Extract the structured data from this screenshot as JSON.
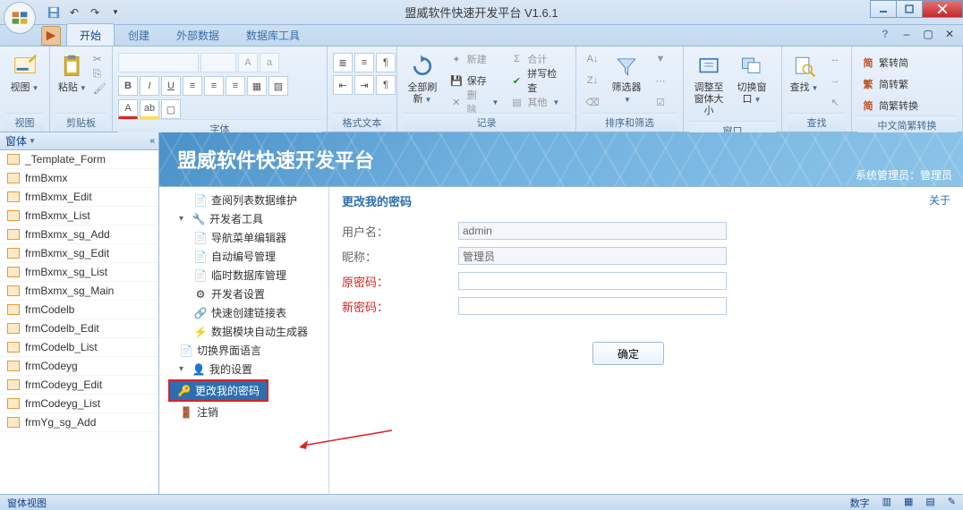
{
  "window": {
    "title": "盟威软件快速开发平台  V1.6.1"
  },
  "tabs": {
    "t0": "开始",
    "t1": "创建",
    "t2": "外部数据",
    "t3": "数据库工具"
  },
  "ribbon": {
    "view": "视图",
    "paste": "粘贴",
    "g_view": "视图",
    "g_clip": "剪贴板",
    "g_font": "字体",
    "g_fmt": "格式文本",
    "g_rec": "记录",
    "g_sort": "排序和筛选",
    "g_win": "窗口",
    "g_find": "查找",
    "g_cn": "中文简繁转换",
    "refresh": "全部刷新",
    "new": "新建",
    "save": "保存",
    "delete": "删除",
    "sum": "合计",
    "spell": "拼写检查",
    "more": "其他",
    "filter": "筛选器",
    "adjust": "调整至窗体大小",
    "switch": "切换窗口",
    "find": "查找",
    "cn1": "繁转简",
    "cn2": "简转繁",
    "cn3": "简繁转换"
  },
  "leftpanel": {
    "hdr": "窗体",
    "items": [
      "_Template_Form",
      "frmBxmx",
      "frmBxmx_Edit",
      "frmBxmx_List",
      "frmBxmx_sg_Add",
      "frmBxmx_sg_Edit",
      "frmBxmx_sg_List",
      "frmBxmx_sg_Main",
      "frmCodelb",
      "frmCodelb_Edit",
      "frmCodelb_List",
      "frmCodeyg",
      "frmCodeyg_Edit",
      "frmCodeyg_List",
      "frmYg_sg_Add"
    ]
  },
  "banner": {
    "title": "盟威软件快速开发平台",
    "user": "系统管理员：管理员"
  },
  "tree": {
    "n0": "查阅列表数据维护",
    "n1": "开发者工具",
    "n1a": "导航菜单编辑器",
    "n1b": "自动编号管理",
    "n1c": "临时数据库管理",
    "n1d": "开发者设置",
    "n1e": "快速创建链接表",
    "n1f": "数据模块自动生成器",
    "n2": "切换界面语言",
    "n3": "我的设置",
    "n3a": "更改我的密码",
    "n4": "注销"
  },
  "form": {
    "title": "更改我的密码",
    "about": "关于",
    "l_user": "用户名：",
    "l_nick": "昵称：",
    "l_old": "原密码：",
    "l_new": "新密码：",
    "v_user": "admin",
    "v_nick": "管理员",
    "btn": "确定"
  },
  "status": {
    "left": "窗体视图",
    "r1": "数字"
  }
}
